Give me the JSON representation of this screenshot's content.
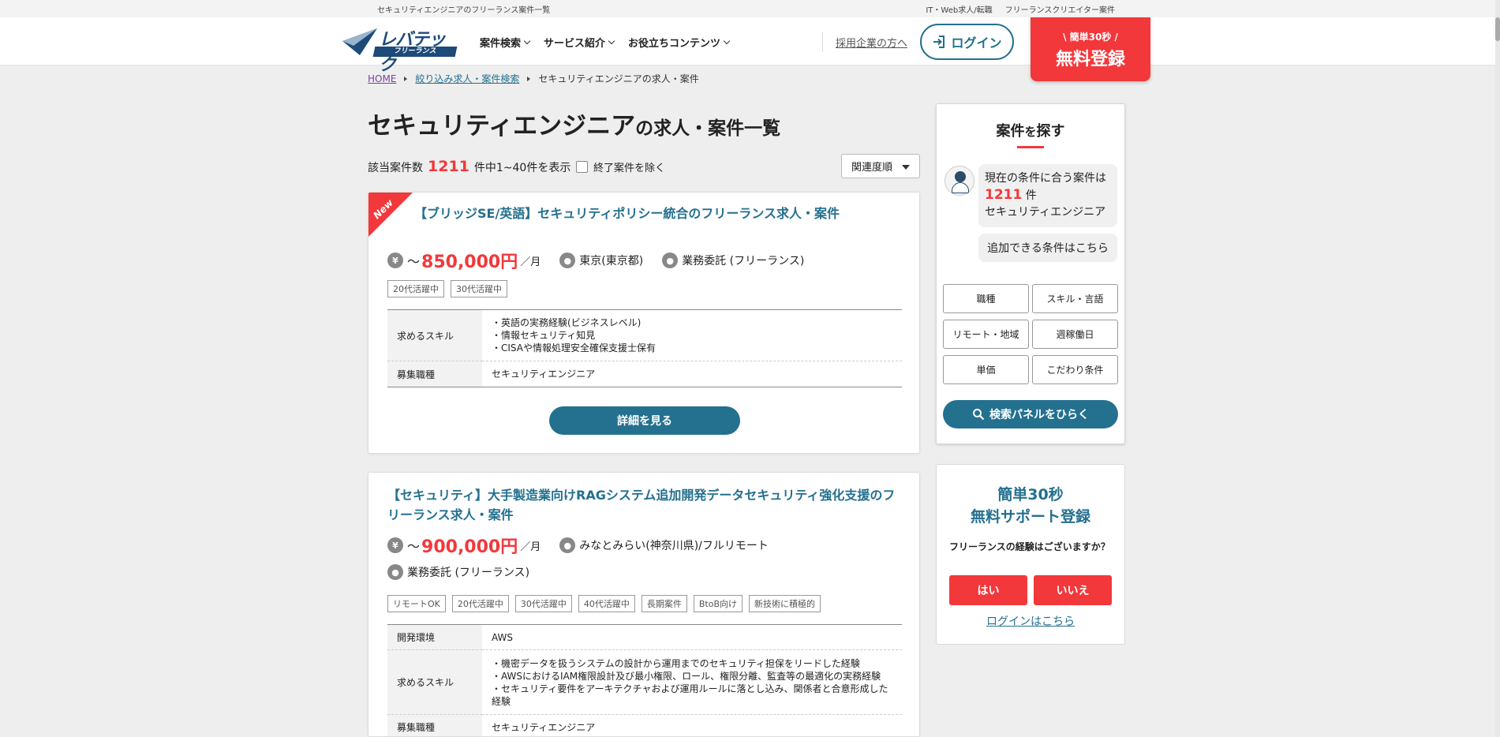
{
  "topbar": {
    "tagline": "セキュリティエンジニアのフリーランス案件一覧",
    "links": [
      "IT・Web求人/転職",
      "フリーランスクリエイター案件"
    ]
  },
  "header": {
    "logo_text": "レバテック",
    "logo_sub": "フリーランス",
    "nav": [
      "案件検索",
      "サービス紹介",
      "お役立ちコンテンツ"
    ],
    "corp_link": "採用企業の方へ",
    "login": "ログイン",
    "register_small": "\\ 簡単30秒 /",
    "register_big": "無料登録"
  },
  "breadcrumb": {
    "home": "HOME",
    "search": "絞り込み求人・案件検索",
    "current": "セキュリティエンジニアの求人・案件"
  },
  "title": {
    "main": "セキュリティエンジニア",
    "suffix": "の求人・案件一覧"
  },
  "results": {
    "prefix": "該当案件数",
    "count": "1211",
    "suffix": "件中1~40件を表示",
    "exclude_label": "終了案件を除く",
    "sort": "関連度順"
  },
  "jobs": [
    {
      "badge": "New",
      "title": "【ブリッジSE/英語】セキュリティポリシー統合のフリーランス求人・案件",
      "price_prefix": "～",
      "price": "850,000円",
      "price_unit": "／月",
      "location": "東京(東京都)",
      "contract": "業務委託 (フリーランス)",
      "tags": [
        "20代活躍中",
        "30代活躍中"
      ],
      "skill_label": "求めるスキル",
      "skills": [
        "・英語の実務経験(ビジネスレベル)",
        "・情報セキュリティ知見",
        "・CISAや情報処理安全確保支援士保有"
      ],
      "role_label": "募集職種",
      "role": "セキュリティエンジニア",
      "detail_button": "詳細を見る"
    },
    {
      "title": "【セキュリティ】大手製造業向けRAGシステム追加開発データセキュリティ強化支援のフリーランス求人・案件",
      "price_prefix": "～",
      "price": "900,000円",
      "price_unit": "／月",
      "location": "みなとみらい(神奈川県)/フルリモート",
      "contract": "業務委託 (フリーランス)",
      "tags": [
        "リモートOK",
        "20代活躍中",
        "30代活躍中",
        "40代活躍中",
        "長期案件",
        "BtoB向け",
        "新技術に積極的"
      ],
      "env_label": "開発環境",
      "env": "AWS",
      "skill_label": "求めるスキル",
      "skills": [
        "・機密データを扱うシステムの設計から運用までのセキュリティ担保をリードした経験",
        "・AWSにおけるIAM権限設計及び最小権限、ロール、権限分離、監査等の最適化の実務経験",
        "・セキュリティ要件をアーキテクチャおよび運用ルールに落とし込み、関係者と合意形成した経験"
      ],
      "role_label": "募集職種",
      "role": "セキュリティエンジニア"
    }
  ],
  "sidebar": {
    "title_a": "案件",
    "title_b": "を",
    "title_c": "探す",
    "bubble_line1": "現在の条件に合う案件は",
    "bubble_count": "1211",
    "bubble_unit": "件",
    "bubble_line3": "セキュリティエンジニア",
    "add_conditions": "追加できる条件はこちら",
    "filters": [
      "職種",
      "スキル・言語",
      "リモート・地域",
      "週稼働日",
      "単価",
      "こだわり条件"
    ],
    "search_panel": "検索パネルをひらく"
  },
  "support": {
    "title_line1": "簡単30秒",
    "title_line2": "無料サポート登録",
    "question": "フリーランスの経験はございますか？",
    "yes": "はい",
    "no": "いいえ",
    "login_link": "ログインはこちら"
  },
  "colors": {
    "accent": "#24708f",
    "red": "#f2383b",
    "navy": "#1e4a7a"
  }
}
